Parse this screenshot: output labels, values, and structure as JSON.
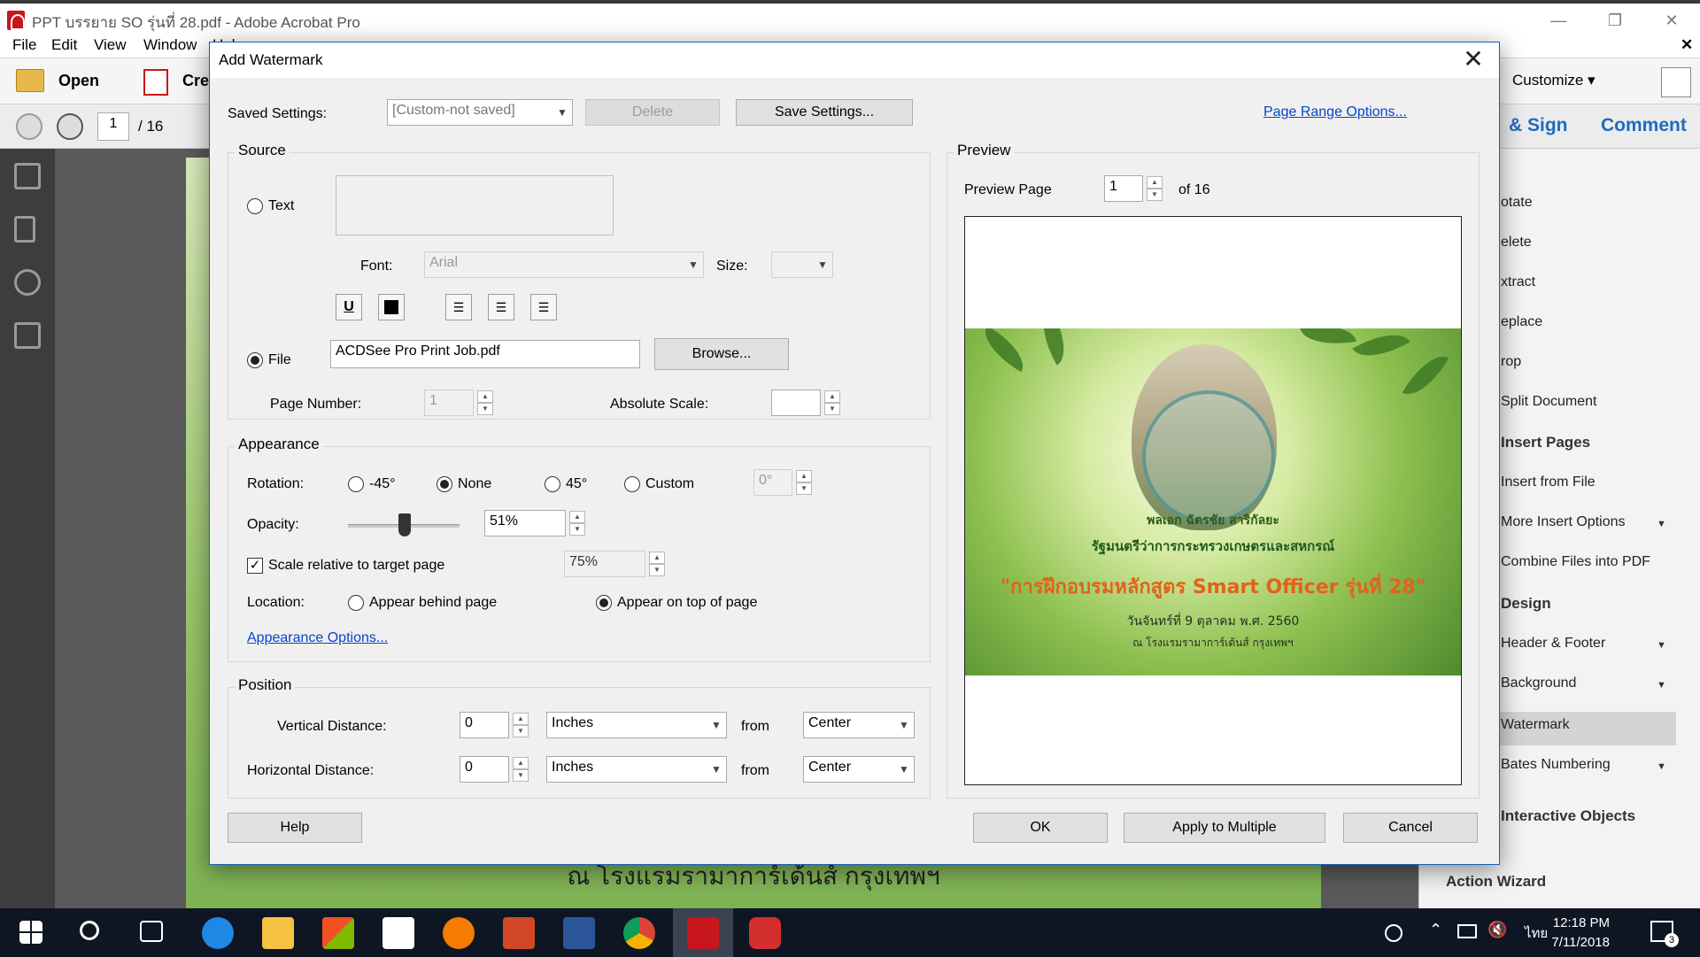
{
  "window": {
    "title": "PPT บรรยาย SO รุ่นที่ 28.pdf - Adobe Acrobat Pro",
    "minimize": "—",
    "restore": "❐",
    "close": "✕"
  },
  "menubar": {
    "items": [
      "File",
      "Edit",
      "View",
      "Window",
      "Help"
    ],
    "doc_close": "✕"
  },
  "toolbar": {
    "open_label": "Open",
    "create_label": "Create",
    "customize_label": "Customize ▾",
    "page_current": "1",
    "page_total": "/ 16"
  },
  "tabs": {
    "sign": "& Sign",
    "comment": "Comment"
  },
  "right_panel": {
    "items": [
      "otate",
      "elete",
      "xtract",
      "eplace",
      "rop",
      "Split Document"
    ],
    "section_pages": "Insert Pages",
    "insert_items": [
      "Insert from File",
      "More Insert Options",
      "Combine Files into PDF"
    ],
    "section_design": "Design",
    "design_items": [
      "Header & Footer",
      "Background",
      "Watermark",
      "Bates Numbering"
    ],
    "interactive": "Interactive Objects",
    "action_wizard": "Action Wizard"
  },
  "document": {
    "bottom_text": "ณ โรงแรมรามาการ์เด้นส์ กรุงเทพฯ"
  },
  "dialog": {
    "title": "Add Watermark",
    "close": "✕",
    "saved_settings_label": "Saved Settings:",
    "saved_settings_value": "[Custom-not saved]",
    "delete_label": "Delete",
    "save_settings_label": "Save Settings...",
    "page_range_label": "Page Range Options...",
    "source": {
      "title": "Source",
      "text_label": "Text",
      "font_label": "Font:",
      "font_value": "Arial",
      "size_label": "Size:",
      "file_label": "File",
      "file_value": "ACDSee Pro Print Job.pdf",
      "browse_label": "Browse...",
      "page_number_label": "Page Number:",
      "page_number_value": "1",
      "absolute_scale_label": "Absolute Scale:"
    },
    "appearance": {
      "title": "Appearance",
      "rotation_label": "Rotation:",
      "rot_m45": "-45°",
      "rot_none": "None",
      "rot_45": "45°",
      "rot_custom": "Custom",
      "rot_custom_value": "0°",
      "opacity_label": "Opacity:",
      "opacity_value": "51%",
      "opacity_fraction": 0.51,
      "scale_label": "Scale relative to target page",
      "scale_value": "75%",
      "location_label": "Location:",
      "behind_label": "Appear behind page",
      "ontop_label": "Appear on top of page",
      "options_link": "Appearance Options..."
    },
    "position": {
      "title": "Position",
      "vertical_label": "Vertical Distance:",
      "vertical_value": "0",
      "vertical_unit": "Inches",
      "vertical_from_label": "from",
      "vertical_from": "Center",
      "horizontal_label": "Horizontal Distance:",
      "horizontal_value": "0",
      "horizontal_unit": "Inches",
      "horizontal_from_label": "from",
      "horizontal_from": "Center"
    },
    "preview": {
      "title": "Preview",
      "page_label": "Preview Page",
      "page_value": "1",
      "page_of": "of 16",
      "slide_name": "พลเอก ฉัตรชัย สาริกัลยะ",
      "slide_role": "รัฐมนตรีว่าการกระทรวงเกษตรและสหกรณ์",
      "slide_headline": "\"การฝึกอบรมหลักสูตร Smart Officer รุ่นที่ 28\"",
      "slide_date": "วันจันทร์ที่ 9 ตุลาคม พ.ศ. 2560",
      "slide_venue": "ณ โรงแรมรามาการ์เด้นส์ กรุงเทพฯ"
    },
    "help_label": "Help",
    "ok_label": "OK",
    "apply_multiple_label": "Apply to Multiple",
    "cancel_label": "Cancel"
  },
  "taskbar": {
    "time": "12:18 PM",
    "date": "7/11/2018",
    "lang": "ไทย",
    "notifications": "3"
  },
  "colors": {
    "link": "#0645c8",
    "acrobat_red": "#c8161d",
    "taskbar": "#0f1623"
  }
}
